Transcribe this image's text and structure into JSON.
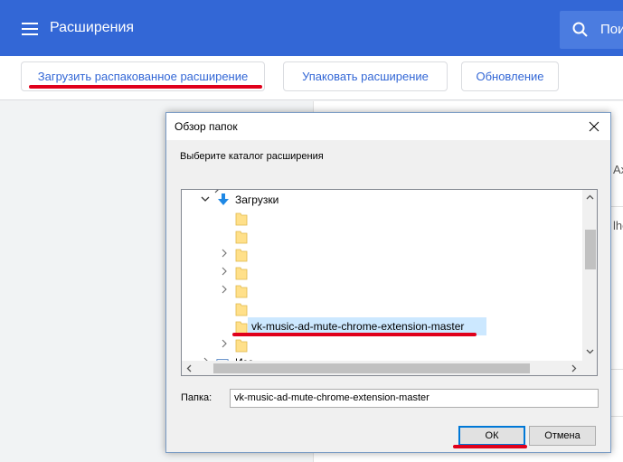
{
  "header": {
    "title": "Расширения",
    "search_text": "Пои",
    "bar_color": "#3367d6"
  },
  "toolbar": {
    "load_unpacked": "Загрузить распакованное расширение",
    "pack": "Упаковать расширение",
    "update": "Обновление"
  },
  "background_card": {
    "fragment_1": "Ax",
    "fragment_2": "lho"
  },
  "dialog": {
    "title": "Обзор папок",
    "prompt": "Выберите каталог расширения",
    "tree": {
      "downloads_label": "Загрузки",
      "selected_folder": "vk-music-ad-mute-chrome-extension-master",
      "partial_bottom_label": "Изо"
    },
    "folder_label": "Папка:",
    "folder_value": "vk-music-ad-mute-chrome-extension-master",
    "ok": "ОК",
    "cancel": "Отмена"
  },
  "highlight_color": "#e0001b"
}
